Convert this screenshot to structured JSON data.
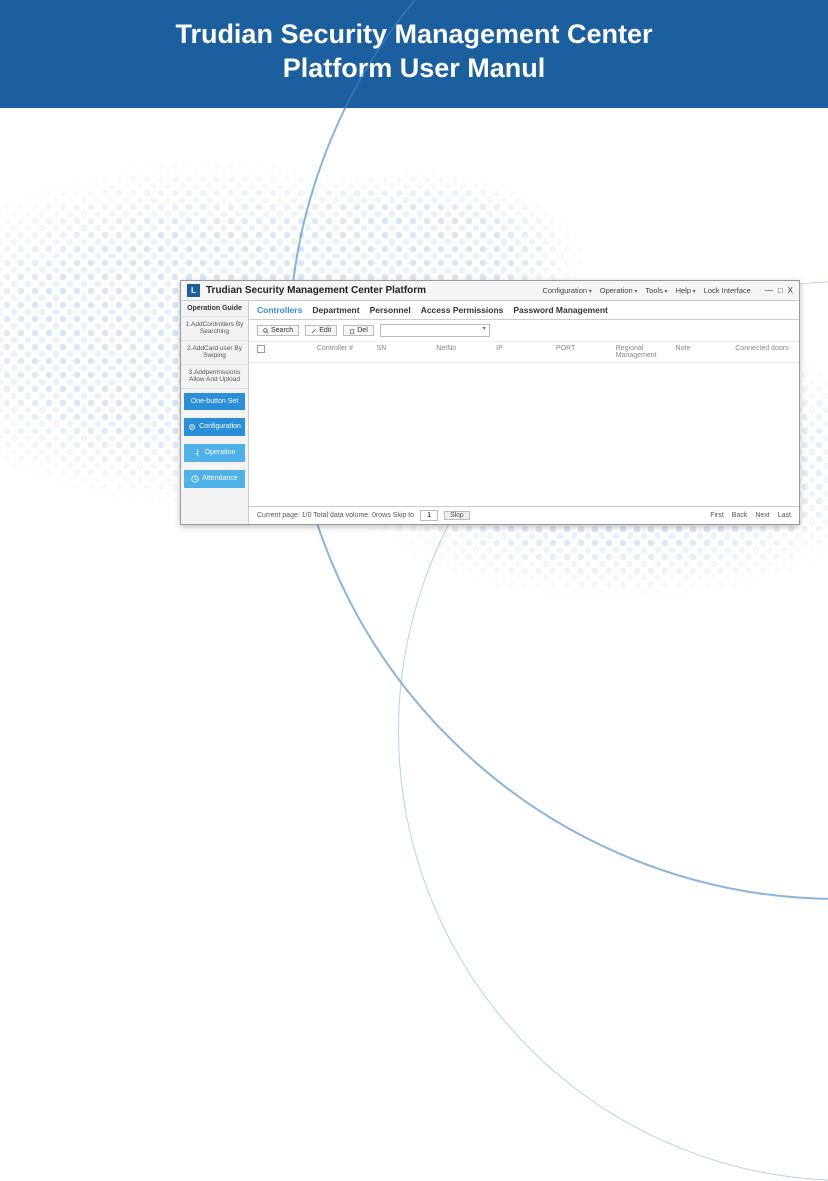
{
  "banner": {
    "line1": "Trudian Security Management Center",
    "line2": "Platform User Manul"
  },
  "app": {
    "title": "Trudian Security Management Center Platform",
    "menu": {
      "configuration": "Configuration",
      "operation": "Operation",
      "tools": "Tools",
      "help": "Help",
      "lock": "Lock Interface"
    },
    "window": {
      "min": "—",
      "max": "□",
      "close": "X"
    },
    "sidebar": {
      "heading": "Operation Guide",
      "steps": [
        "1.AddControllers By Searching",
        "2.AddCard user By Swiping",
        "3.Addpermissions Allow And Upload"
      ],
      "basic": "One-button Set",
      "config": "Configuration",
      "operation": "Operation",
      "attendance": "Attendance"
    },
    "tabs": {
      "controllers": "Controllers",
      "department": "Department",
      "personnel": "Personnel",
      "access": "Access Permissions",
      "password": "Password Management"
    },
    "toolbar": {
      "search": "Search",
      "edit": "Edit",
      "del": "Del"
    },
    "columns": {
      "controller": "Controller #",
      "sn": "SN",
      "netno": "NetNo",
      "ip": "IP",
      "port": "PORT",
      "regional": "Regional Management",
      "note": "Note",
      "connected": "Connected doors"
    },
    "pager": {
      "left": "Current page: 1/0   Total data volume: 0rows  Skip to",
      "skip_value": "1",
      "skip": "Skip",
      "first": "First",
      "back": "Back",
      "next": "Next",
      "last": "Last"
    }
  }
}
